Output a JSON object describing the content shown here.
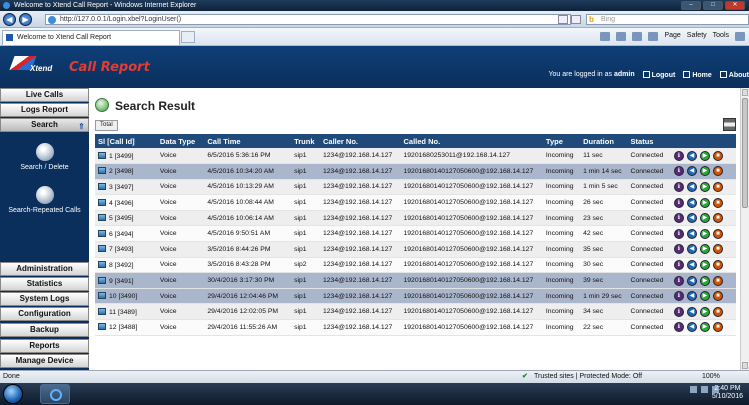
{
  "browser": {
    "window_title": "Welcome to Xtend Call Report - Windows Internet Explorer",
    "url": "http://127.0.0.1/Login.xbel?LoginUser()",
    "search_placeholder": "Bing",
    "tab_title": "Welcome to Xtend Call Report",
    "commands": [
      "Page",
      "Safety",
      "Tools"
    ]
  },
  "header": {
    "brand": "Xtend",
    "title": "Call Report",
    "logged_in_text": "You are logged in as",
    "username": "admin",
    "logout": "Logout",
    "home": "Home",
    "about": "About"
  },
  "sidebar": {
    "top_items": [
      "Live Calls",
      "Logs Report",
      "Search"
    ],
    "sub_items": [
      "Search / Delete",
      "Search-Repeated Calls"
    ],
    "bottom_items": [
      "Administration",
      "Statistics",
      "System Logs",
      "Configuration",
      "Backup",
      "Reports",
      "Manage Device"
    ]
  },
  "main": {
    "page_title": "Search Result",
    "total_label": "Total",
    "columns": [
      "Sl [Call Id]",
      "Data Type",
      "Call Time",
      "Trunk",
      "Caller No.",
      "Called No.",
      "Type",
      "Duration",
      "Status"
    ],
    "rows": [
      {
        "sl": "1 [3499]",
        "data_type": "Voice",
        "call_time": "6/5/2016 5:36:16 PM",
        "trunk": "sip1",
        "caller": "1234@192.168.14.127",
        "called": "19201680253011@192.168.14.127",
        "type": "Incoming",
        "duration": "11 sec",
        "status": "Connected"
      },
      {
        "sl": "2 [3498]",
        "data_type": "Voice",
        "call_time": "4/5/2016 10:34:20 AM",
        "trunk": "sip1",
        "caller": "1234@192.168.14.127",
        "called": "19201680140127050600@192.168.14.127",
        "type": "Incoming",
        "duration": "1 min 14 sec",
        "status": "Connected"
      },
      {
        "sl": "3 [3497]",
        "data_type": "Voice",
        "call_time": "4/5/2016 10:13:29 AM",
        "trunk": "sip1",
        "caller": "1234@192.168.14.127",
        "called": "19201680140127050600@192.168.14.127",
        "type": "Incoming",
        "duration": "1 min 5 sec",
        "status": "Connected"
      },
      {
        "sl": "4 [3496]",
        "data_type": "Voice",
        "call_time": "4/5/2016 10:08:44 AM",
        "trunk": "sip1",
        "caller": "1234@192.168.14.127",
        "called": "19201680140127050600@192.168.14.127",
        "type": "Incoming",
        "duration": "26 sec",
        "status": "Connected"
      },
      {
        "sl": "5 [3495]",
        "data_type": "Voice",
        "call_time": "4/5/2016 10:06:14 AM",
        "trunk": "sip1",
        "caller": "1234@192.168.14.127",
        "called": "19201680140127050600@192.168.14.127",
        "type": "Incoming",
        "duration": "23 sec",
        "status": "Connected"
      },
      {
        "sl": "6 [3494]",
        "data_type": "Voice",
        "call_time": "4/5/2016 9:50:51 AM",
        "trunk": "sip1",
        "caller": "1234@192.168.14.127",
        "called": "19201680140127050600@192.168.14.127",
        "type": "Incoming",
        "duration": "42 sec",
        "status": "Connected"
      },
      {
        "sl": "7 [3493]",
        "data_type": "Voice",
        "call_time": "3/5/2016 8:44:26 PM",
        "trunk": "sip1",
        "caller": "1234@192.168.14.127",
        "called": "19201680140127050600@192.168.14.127",
        "type": "Incoming",
        "duration": "35 sec",
        "status": "Connected"
      },
      {
        "sl": "8 [3492]",
        "data_type": "Voice",
        "call_time": "3/5/2016 8:43:28 PM",
        "trunk": "sip2",
        "caller": "1234@192.168.14.127",
        "called": "19201680140127050600@192.168.14.127",
        "type": "Incoming",
        "duration": "30 sec",
        "status": "Connected"
      },
      {
        "sl": "9 [3491]",
        "data_type": "Voice",
        "call_time": "30/4/2016 3:17:30 PM",
        "trunk": "sip1",
        "caller": "1234@192.168.14.127",
        "called": "19201680140127050600@192.168.14.127",
        "type": "Incoming",
        "duration": "39 sec",
        "status": "Connected"
      },
      {
        "sl": "10 [3490]",
        "data_type": "Voice",
        "call_time": "29/4/2016 12:04:46 PM",
        "trunk": "sip1",
        "caller": "1234@192.168.14.127",
        "called": "19201680140127050600@192.168.14.127",
        "type": "Incoming",
        "duration": "1 min 29 sec",
        "status": "Connected"
      },
      {
        "sl": "11 [3489]",
        "data_type": "Voice",
        "call_time": "29/4/2016 12:02:05 PM",
        "trunk": "sip1",
        "caller": "1234@192.168.14.127",
        "called": "19201680140127050600@192.168.14.127",
        "type": "Incoming",
        "duration": "34 sec",
        "status": "Connected"
      },
      {
        "sl": "12 [3488]",
        "data_type": "Voice",
        "call_time": "29/4/2016 11:55:26 AM",
        "trunk": "sip1",
        "caller": "1234@192.168.14.127",
        "called": "19201680140127050600@192.168.14.127",
        "type": "Incoming",
        "duration": "22 sec",
        "status": "Connected"
      }
    ]
  },
  "status_bar": {
    "left": "Done",
    "zone": "Trusted sites | Protected Mode: Off",
    "zoom": "100%"
  },
  "taskbar": {
    "time": "2:40 PM",
    "date": "5/10/2016"
  },
  "colors": {
    "header_bg": "#0f3f78",
    "accent_red": "#e53b30",
    "table_header": "#1f4a7a",
    "highlight_row": "#aab6cc"
  }
}
